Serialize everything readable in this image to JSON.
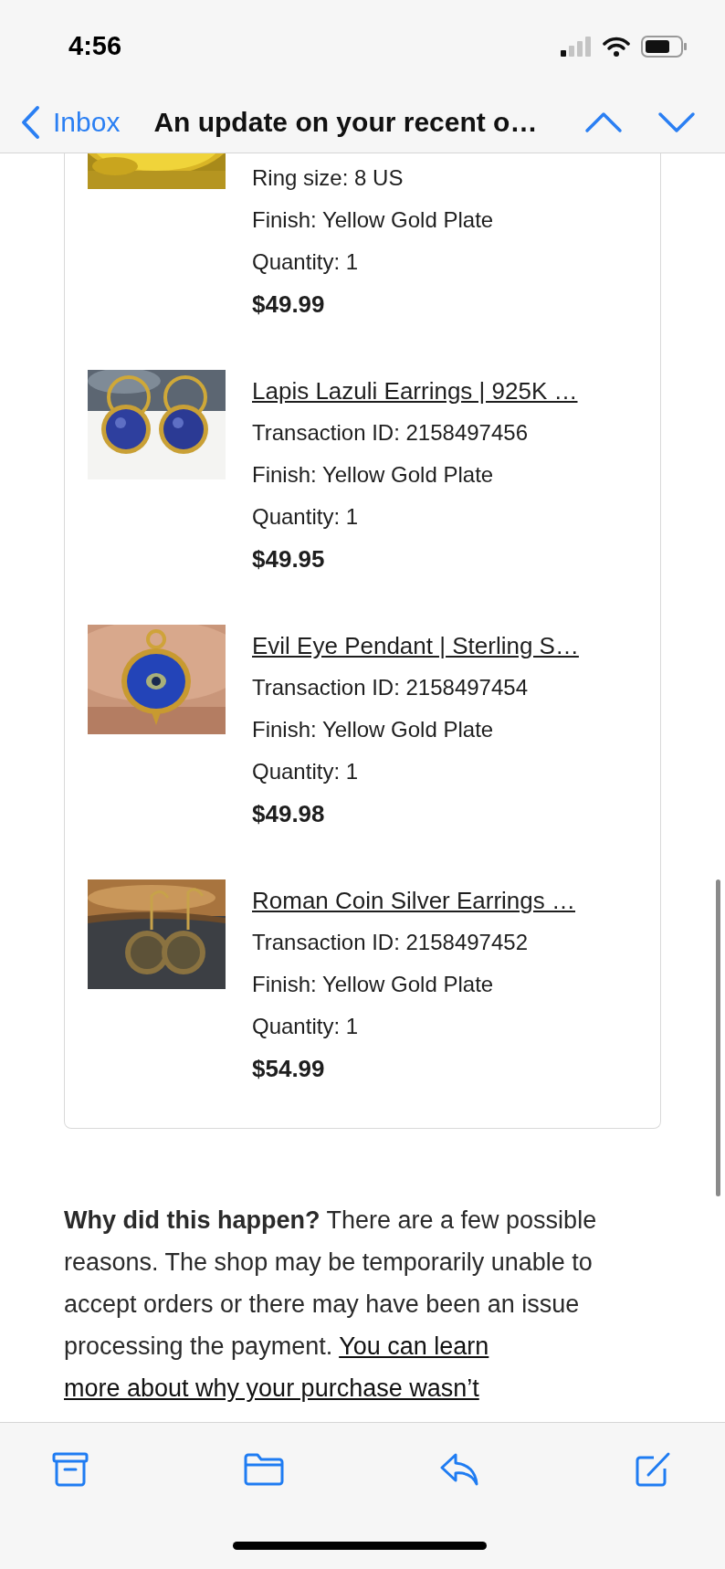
{
  "status_bar": {
    "time": "4:56"
  },
  "nav": {
    "back": "Inbox",
    "title": "An update on your recent o…"
  },
  "items": [
    {
      "details": [
        "Ring size: 8 US",
        "Finish: Yellow Gold Plate",
        "Quantity: 1"
      ],
      "price": "$49.99"
    },
    {
      "title": "Lapis Lazuli Earrings | 925K …",
      "details": [
        "Transaction ID: 2158497456",
        "Finish: Yellow Gold Plate",
        "Quantity: 1"
      ],
      "price": "$49.95"
    },
    {
      "title": "Evil Eye Pendant | Sterling S…",
      "details": [
        "Transaction ID: 2158497454",
        "Finish: Yellow Gold Plate",
        "Quantity: 1"
      ],
      "price": "$49.98"
    },
    {
      "title": "Roman Coin Silver Earrings …",
      "details": [
        "Transaction ID: 2158497452",
        "Finish: Yellow Gold Plate",
        "Quantity: 1"
      ],
      "price": "$54.99"
    }
  ],
  "explanation": {
    "text": "**Why did this happen?** There are a few possible reasons. The shop may be temporarily unable to accept orders or there may have been an issue processing the payment.",
    "link_lines": [
      "You can learn",
      "more about why your purchase wasn’t"
    ]
  }
}
